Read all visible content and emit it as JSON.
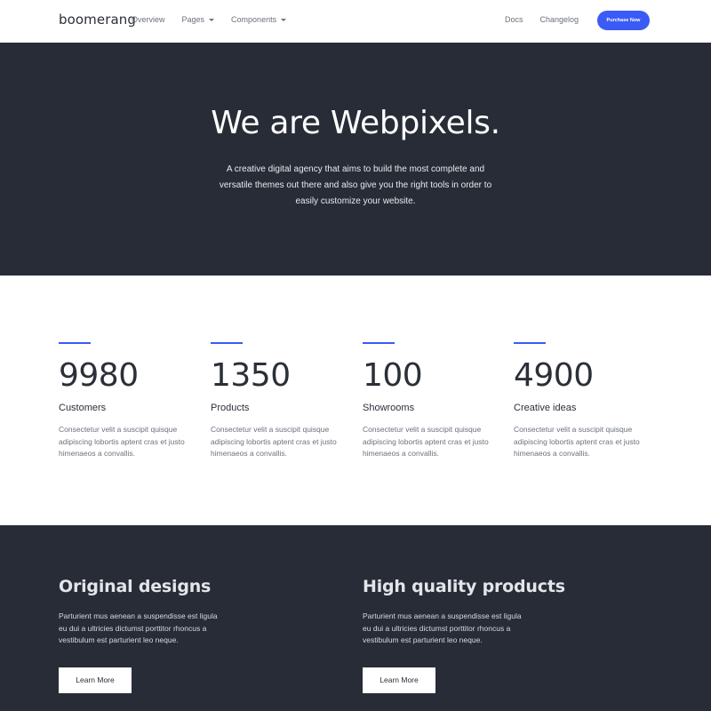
{
  "navbar": {
    "brand": "boomerang",
    "left_links": [
      {
        "label": "Overview"
      },
      {
        "label": "Pages"
      },
      {
        "label": "Components"
      }
    ],
    "right_links": [
      {
        "label": "Docs"
      },
      {
        "label": "Changelog"
      }
    ],
    "cta": "Purchase Now"
  },
  "hero": {
    "title": "We are Webpixels.",
    "text": "A creative digital agency that aims to build the most complete and versatile themes out there and also give you the right tools in order to easily customize your website."
  },
  "stats": [
    {
      "number": "9980",
      "label": "Customers",
      "desc": "Consectetur velit a suscipit quisque adipiscing lobortis aptent cras et justo himenaeos a convallis."
    },
    {
      "number": "1350",
      "label": "Products",
      "desc": "Consectetur velit a suscipit quisque adipiscing lobortis aptent cras et justo himenaeos a convallis."
    },
    {
      "number": "100",
      "label": "Showrooms",
      "desc": "Consectetur velit a suscipit quisque adipiscing lobortis aptent cras et justo himenaeos a convallis."
    },
    {
      "number": "4900",
      "label": "Creative ideas",
      "desc": "Consectetur velit a suscipit quisque adipiscing lobortis aptent cras et justo himenaeos a convallis."
    }
  ],
  "features": [
    {
      "title": "Original designs",
      "text": "Parturient mus aenean a suspendisse est ligula eu dui a ultricies dictumst porttitor rhoncus a vestibulum est parturient leo neque.",
      "button": "Learn More"
    },
    {
      "title": "High quality products",
      "text": "Parturient mus aenean a suspendisse est ligula eu dui a ultricies dictumst porttitor rhoncus a vestibulum est parturient leo neque.",
      "button": "Learn More"
    }
  ],
  "colors": {
    "accent": "#3b5bf6",
    "dark_section": "#272c36"
  }
}
